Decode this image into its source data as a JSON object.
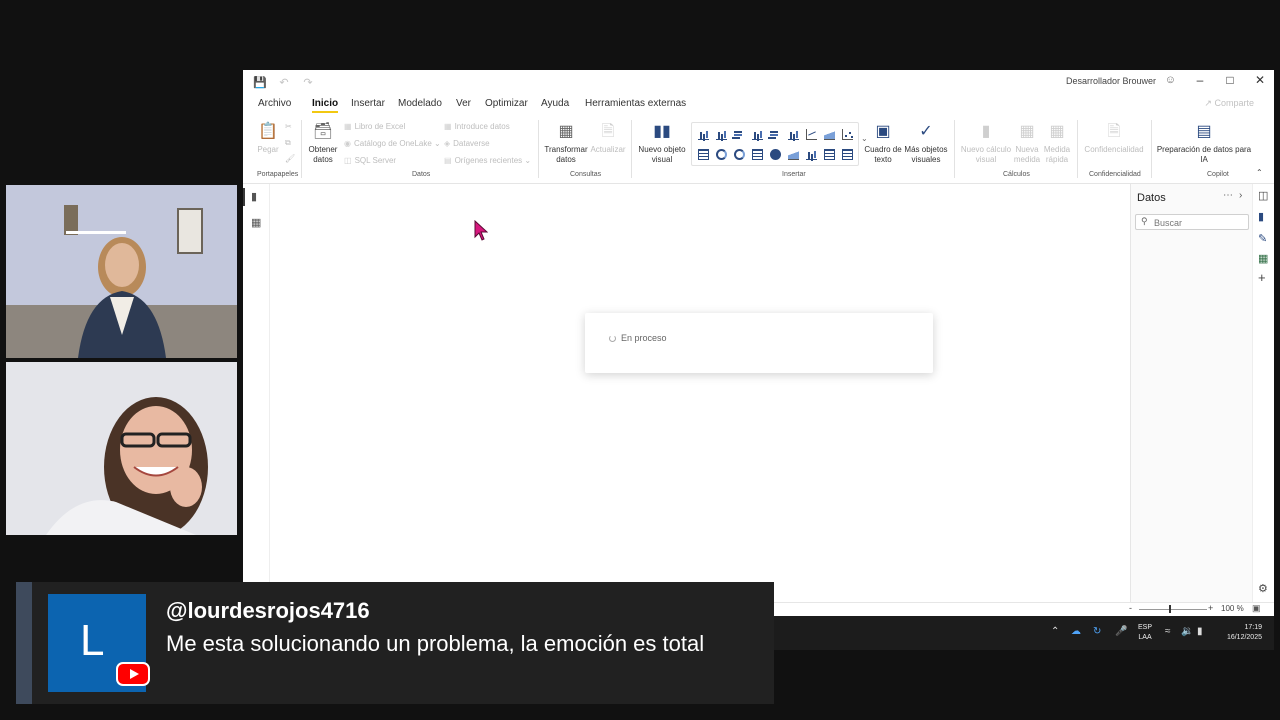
{
  "titlebar": {
    "user_name": "Desarrollador Brouwer",
    "icons": [
      "save-icon",
      "undo-icon",
      "redo-icon"
    ]
  },
  "menu": {
    "tabs": [
      "Archivo",
      "Inicio",
      "Insertar",
      "Modelado",
      "Ver",
      "Optimizar",
      "Ayuda",
      "Herramientas externas"
    ],
    "active_tab": "Inicio",
    "share": "Comparte"
  },
  "ribbon": {
    "pegar": "Pegar",
    "portapapeles": "Portapapeles",
    "obtener_datos": "Obtener datos",
    "libro_excel": "Libro de Excel",
    "catalogo_onelake": "Catálogo de OneLake",
    "sql_server": "SQL Server",
    "introduce_datos": "Introduce datos",
    "dataverse": "Dataverse",
    "origenes_recientes": "Orígenes recientes",
    "datos": "Datos",
    "transformar_datos": "Transformar datos",
    "actualizar": "Actualizar",
    "consultas": "Consultas",
    "nuevo_objeto_visual": "Nuevo objeto visual",
    "insertar": "Insertar",
    "cuadro_texto": "Cuadro de texto",
    "mas_objetos_visuales": "Más objetos visuales",
    "nuevo_calculo_visual": "Nuevo cálculo visual",
    "nueva_medida": "Nueva medida",
    "medida_rapida": "Medida rápida",
    "calculos": "Cálculos",
    "confidencialidad_btn": "Confidencialidad",
    "confidencialidad": "Confidencialidad",
    "preparacion_ia": "Preparación de datos para IA",
    "copilot": "Copilot"
  },
  "canvas": {
    "loading_text": "En proceso"
  },
  "data_pane": {
    "title": "Datos",
    "search_placeholder": "Buscar"
  },
  "statusbar": {
    "zoom": "100 %"
  },
  "taskbar": {
    "lang_line1": "ESP",
    "lang_line2": "LAA",
    "time": "17:19",
    "date": "16/12/2025"
  },
  "chat": {
    "avatar_letter": "L",
    "username": "@lourdesrojos4716",
    "message": "Me esta solucionando un problema, la emoción es total",
    "colors": {
      "avatar": "#0c64b0",
      "badge": "#ff0000",
      "background": "#212121"
    }
  }
}
